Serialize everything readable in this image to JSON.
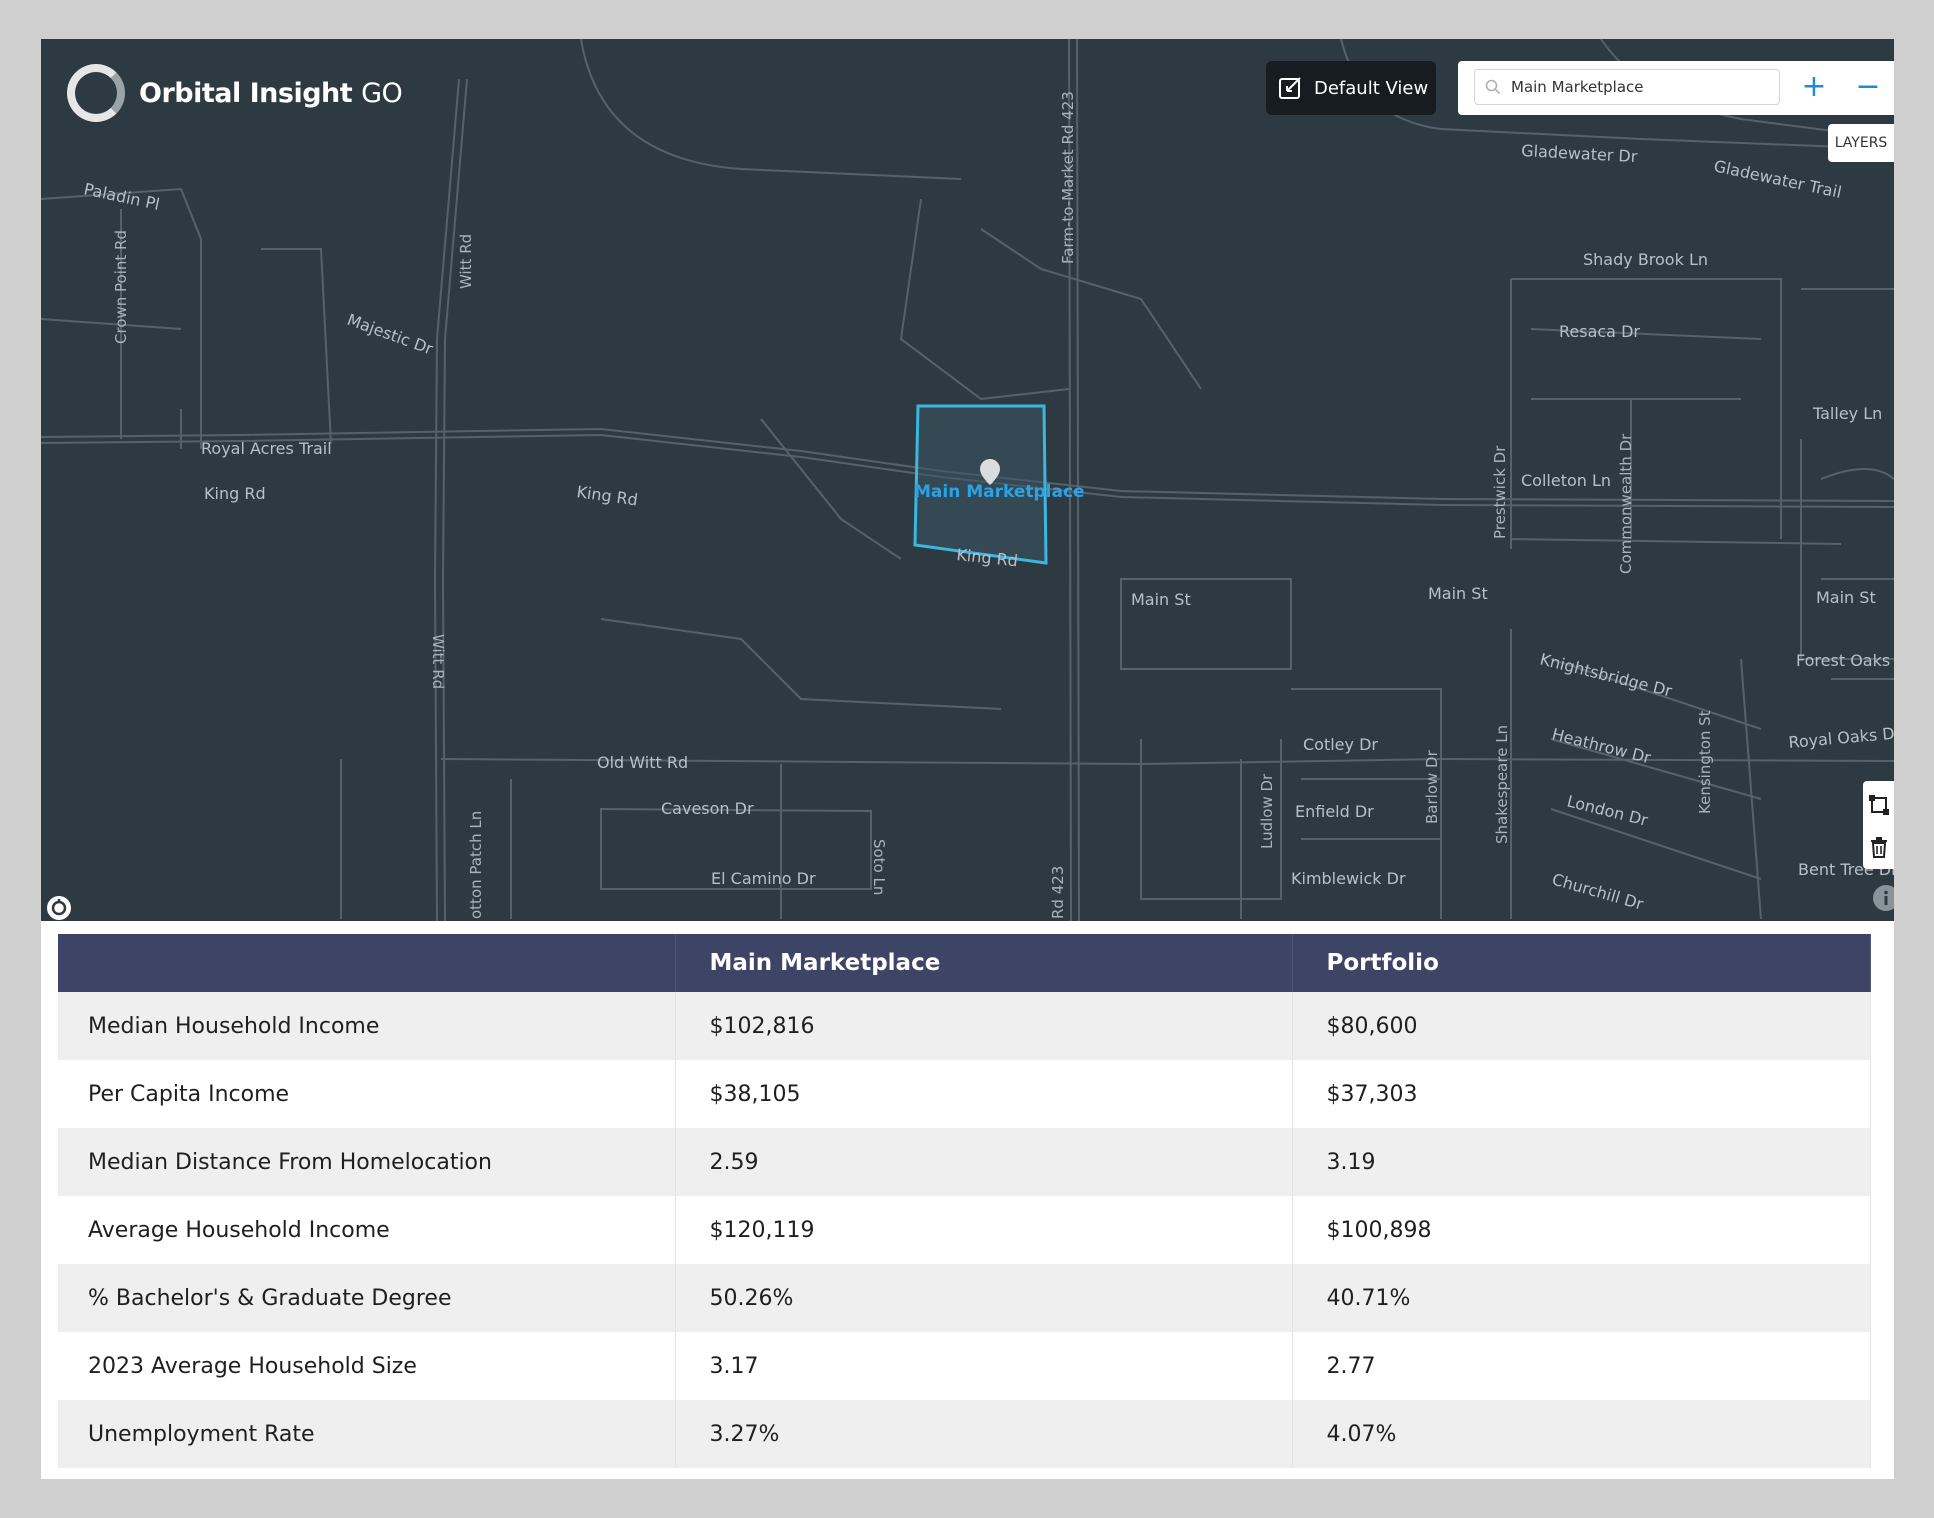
{
  "app": {
    "brand": "Orbital Insight",
    "brand_suffix": "GO"
  },
  "toolbar": {
    "default_view_label": "Default View",
    "search_value": "Main Marketplace",
    "zoom_in": "+",
    "zoom_out": "−",
    "layers_label": "LAYERS"
  },
  "map": {
    "aoi_label": "Main Marketplace",
    "streets": {
      "s1": "Paladin Pl",
      "s2": "Crown Point Rd",
      "s3": "Witt Rd",
      "s4": "Majestic Dr",
      "s5": "Royal Acres Trail",
      "s6": "King Rd",
      "s7": "King Rd",
      "s8": "King Rd",
      "s9": "Farm-to-Market Rd 423",
      "s10": "Main St",
      "s11": "Main St",
      "s12": "Main St",
      "s13": "Witt Rd",
      "s14": "Old Witt Rd",
      "s15": "Caveson Dr",
      "s16": "El Camino Dr",
      "s17": "Soto Ln",
      "s18": "otton Patch Ln",
      "s19": "Rd 423",
      "s20": "Gladewater Dr",
      "s21": "Gladewater Trail",
      "s22": "Shady Brook Ln",
      "s23": "Resaca Dr",
      "s24": "Talley Ln",
      "s25": "Colleton Ln",
      "s26": "Prestwick Dr",
      "s27": "Commonwealth Dr",
      "s28": "Knightsbridge Dr",
      "s29": "Forest Oaks",
      "s30": "Heathrow Dr",
      "s31": "Royal Oaks Dr",
      "s32": "Kensington St",
      "s33": "London Dr",
      "s34": "Shakespeare Ln",
      "s35": "Cotley Dr",
      "s36": "Enfield Dr",
      "s37": "Kimblewick Dr",
      "s38": "Ludlow Dr",
      "s39": "Barlow Dr",
      "s40": "Churchill Dr",
      "s41": "Bent Tree Dr"
    }
  },
  "table": {
    "headers": [
      "",
      "Main Marketplace",
      "Portfolio"
    ],
    "rows": [
      [
        "Median Household Income",
        "$102,816",
        "$80,600"
      ],
      [
        "Per Capita Income",
        "$38,105",
        "$37,303"
      ],
      [
        "Median Distance From Homelocation",
        "2.59",
        "3.19"
      ],
      [
        "Average Household Income",
        "$120,119",
        "$100,898"
      ],
      [
        "% Bachelor's & Graduate Degree",
        "50.26%",
        "40.71%"
      ],
      [
        "2023 Average Household Size",
        "3.17",
        "2.77"
      ],
      [
        "Unemployment Rate",
        "3.27%",
        "4.07%"
      ]
    ]
  },
  "icons": {
    "logo": "orbital-ring-logo",
    "default_view": "edit-square-icon",
    "search": "search-icon",
    "draw": "draw-shape-icon",
    "delete": "trash-icon",
    "compass": "compass-icon",
    "info": "info-icon"
  },
  "colors": {
    "map_bg": "#2d3a42",
    "aoi_stroke": "#3bb7e0",
    "aoi_label": "#2aa3e6",
    "table_header": "#3d4465",
    "accent": "#1f8ad8"
  }
}
